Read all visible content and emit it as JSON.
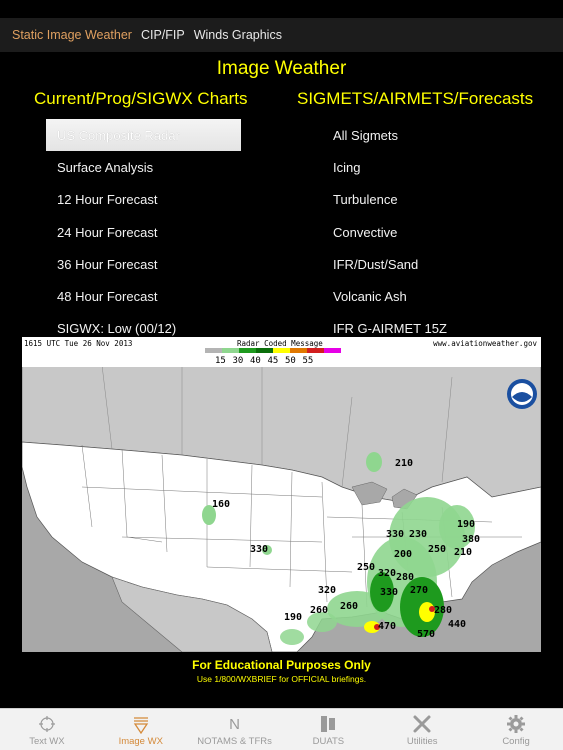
{
  "topnav": {
    "tabs": [
      {
        "label": "Static Image Weather",
        "active": true
      },
      {
        "label": "CIP/FIP",
        "active": false
      },
      {
        "label": "Winds Graphics",
        "active": false
      }
    ]
  },
  "page": {
    "title": "Image Weather",
    "left_heading": "Current/Prog/SIGWX Charts",
    "right_heading": "SIGMETS/AIRMETS/Forecasts"
  },
  "left_list": [
    "US Composite Radar",
    "Surface Analysis",
    "12 Hour Forecast",
    "24 Hour Forecast",
    "36 Hour Forecast",
    "48 Hour Forecast",
    "SIGWX: Low (00/12)"
  ],
  "right_list": [
    "All Sigmets",
    "Icing",
    "Turbulence",
    "Convective",
    "IFR/Dust/Sand",
    "Volcanic Ash",
    "IFR G-AIRMET  15Z"
  ],
  "selected_left_index": 0,
  "map": {
    "timestamp": "1615 UTC Tue 26 Nov 2013",
    "legend_title": "Radar Coded Message",
    "site": "www.aviationweather.gov",
    "legend_colors": [
      "#b4b4b4",
      "#8fd68f",
      "#1e9a1e",
      "#0a6e0a",
      "#ffff00",
      "#e07800",
      "#d21e1e",
      "#e600e6"
    ],
    "legend_values": [
      "15",
      "30",
      "40",
      "45",
      "50",
      "55"
    ],
    "cell_tops": [
      {
        "label": "210"
      },
      {
        "label": "160"
      },
      {
        "label": "330"
      },
      {
        "label": "330"
      },
      {
        "label": "230"
      },
      {
        "label": "190"
      },
      {
        "label": "380"
      },
      {
        "label": "250"
      },
      {
        "label": "200"
      },
      {
        "label": "210"
      },
      {
        "label": "250"
      },
      {
        "label": "320"
      },
      {
        "label": "280"
      },
      {
        "label": "320"
      },
      {
        "label": "330"
      },
      {
        "label": "270"
      },
      {
        "label": "190"
      },
      {
        "label": "260"
      },
      {
        "label": "260"
      },
      {
        "label": "280"
      },
      {
        "label": "440"
      },
      {
        "label": "470"
      },
      {
        "label": "570"
      }
    ]
  },
  "footer": {
    "main": "For Educational Purposes Only",
    "sub": "Use 1/800/WXBRIEF for OFFICIAL briefings."
  },
  "tabbar": [
    {
      "label": "Text WX",
      "icon": "crosshair-icon",
      "active": false
    },
    {
      "label": "Image WX",
      "icon": "image-weather-icon",
      "active": true
    },
    {
      "label": "NOTAMS & TFRs",
      "icon": "notams-icon",
      "active": false
    },
    {
      "label": "DUATS",
      "icon": "duats-icon",
      "active": false
    },
    {
      "label": "Utilities",
      "icon": "tools-icon",
      "active": false
    },
    {
      "label": "Config",
      "icon": "gear-icon",
      "active": false
    }
  ]
}
